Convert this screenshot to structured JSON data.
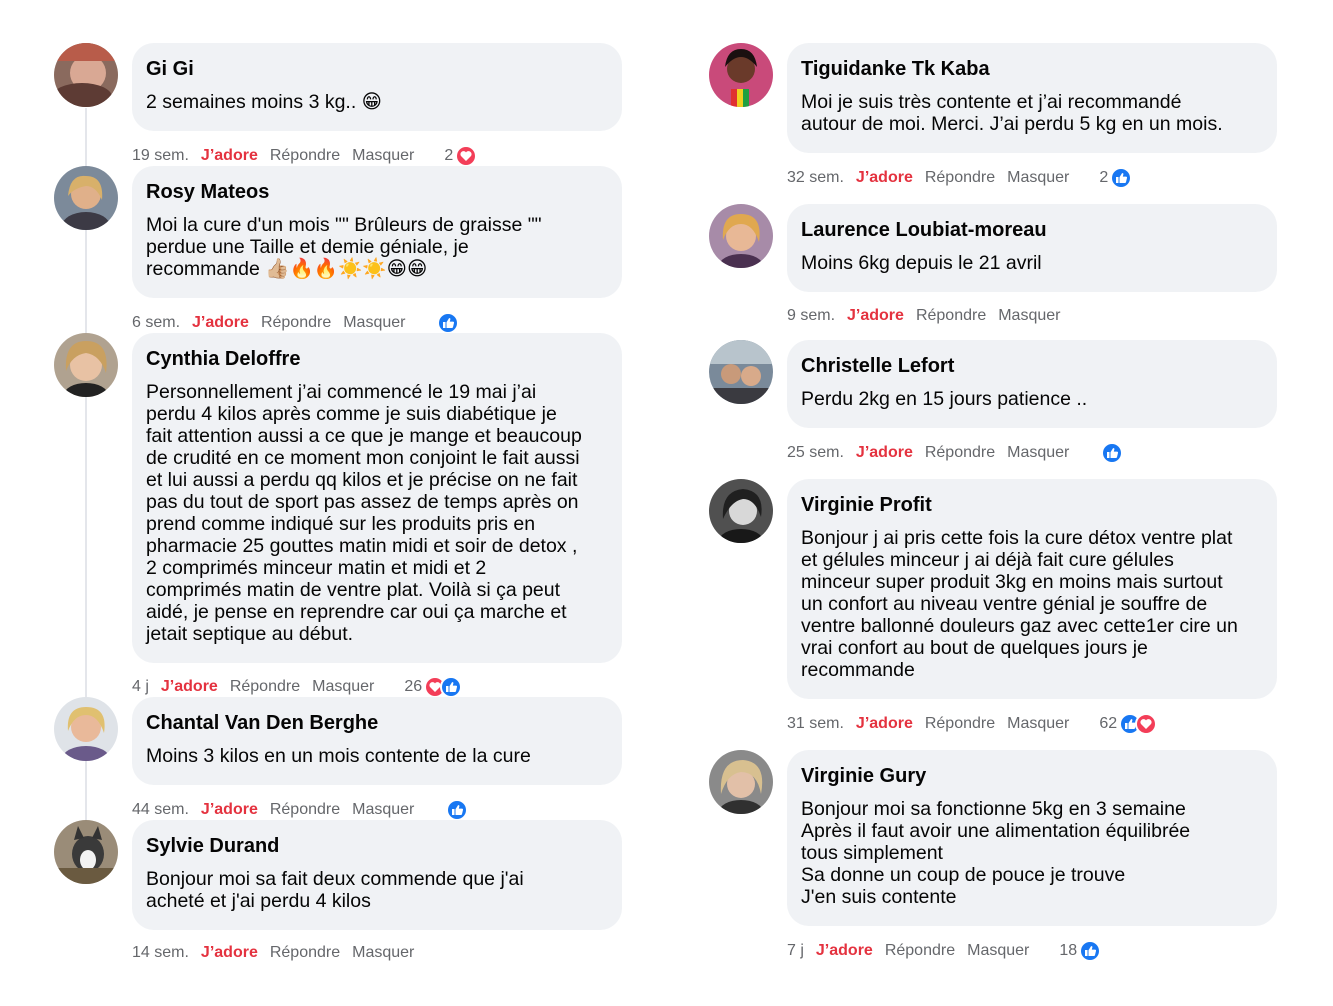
{
  "actions": {
    "like": "J’adore",
    "reply": "Répondre",
    "hide": "Masquer"
  },
  "colors": {
    "bubble": "#f0f2f5",
    "like": "#e4323f",
    "meta": "#65676b",
    "thumb": "#1877f2",
    "love": "#f33e58"
  },
  "left_comments": [
    {
      "author": "Gi Gi",
      "text": "2 semaines moins 3 kg.. 😁",
      "time": "19 sem.",
      "count": "2",
      "reactions": [
        "love"
      ],
      "avatar": "avatar-photo-woman"
    },
    {
      "author": "Rosy Mateos",
      "text": "Moi la cure d'un mois \"\" Brûleurs de graisse \"\"\nperdue une Taille et demie géniale, je\nrecommande 👍🏼🔥🔥☀️☀️😁😁",
      "time": "6 sem.",
      "count": "",
      "reactions": [
        "thumb"
      ],
      "avatar": "avatar-photo-woman"
    },
    {
      "author": "Cynthia Deloffre",
      "text": "Personnellement j’ai commencé le 19 mai j’ai\nperdu 4 kilos après comme je suis diabétique je\nfait attention aussi a ce que je mange et beaucoup\nde crudité en ce moment mon conjoint le fait aussi\net lui aussi a perdu qq kilos et je précise on ne fait\npas du tout de sport pas assez de temps après on\nprend comme indiqué sur les produits pris en\npharmacie 25 gouttes matin midi et soir de detox ,\n2 comprimés minceur matin et midi et 2\ncomprimés matin de ventre plat. Voilà si ça peut\naidé, je pense en reprendre car oui ça marche et\njetait septique au début.",
      "time": "4 j",
      "count": "26",
      "reactions": [
        "love",
        "thumb"
      ],
      "avatar": "avatar-photo-woman"
    },
    {
      "author": "Chantal Van Den Berghe",
      "text": "Moins 3 kilos en un mois contente de la cure",
      "time": "44 sem.",
      "count": "",
      "reactions": [
        "thumb"
      ],
      "avatar": "avatar-photo-woman"
    },
    {
      "author": "Sylvie Durand",
      "text": "Bonjour moi sa fait deux commende que j'ai\nacheté et j'ai perdu 4 kilos",
      "time": "14 sem.",
      "count": "",
      "reactions": [],
      "avatar": "avatar-photo-dog"
    }
  ],
  "right_comments": [
    {
      "author": "Tiguidanke Tk Kaba",
      "text": "Moi je suis très contente et j’ai recommandé\nautour de moi. Merci. J’ai perdu 5 kg en un mois.",
      "time": "32 sem.",
      "count": "2",
      "reactions": [
        "thumb"
      ],
      "avatar": "avatar-photo-woman"
    },
    {
      "author": "Laurence Loubiat-moreau",
      "text": "Moins 6kg depuis le 21 avril",
      "time": "9 sem.",
      "count": "",
      "reactions": [],
      "avatar": "avatar-photo-woman"
    },
    {
      "author": "Christelle Lefort",
      "text": "Perdu 2kg en 15 jours patience ..",
      "time": "25 sem.",
      "count": "",
      "reactions": [
        "thumb"
      ],
      "avatar": "avatar-photo-couple"
    },
    {
      "author": "Virginie Profit",
      "text": "Bonjour j ai pris cette fois la cure détox ventre plat\net gélules minceur j ai déjà fait cure gélules\nminceur super produit 3kg en moins mais surtout\nun confort au niveau ventre génial je souffre de\nventre ballonné douleurs gaz avec cette1er cire un\nvrai confort au bout de quelques jours je\nrecommande",
      "time": "31 sem.",
      "count": "62",
      "reactions": [
        "thumb",
        "love"
      ],
      "avatar": "avatar-photo-woman"
    },
    {
      "author": "Virginie Gury",
      "text": "Bonjour moi sa fonctionne 5kg en 3 semaine\n Après il faut avoir une alimentation équilibrée\ntous simplement\n Sa donne un coup de pouce je trouve\n J'en suis contente",
      "time": "7 j",
      "count": "18",
      "reactions": [
        "thumb"
      ],
      "avatar": "avatar-photo-woman"
    }
  ]
}
